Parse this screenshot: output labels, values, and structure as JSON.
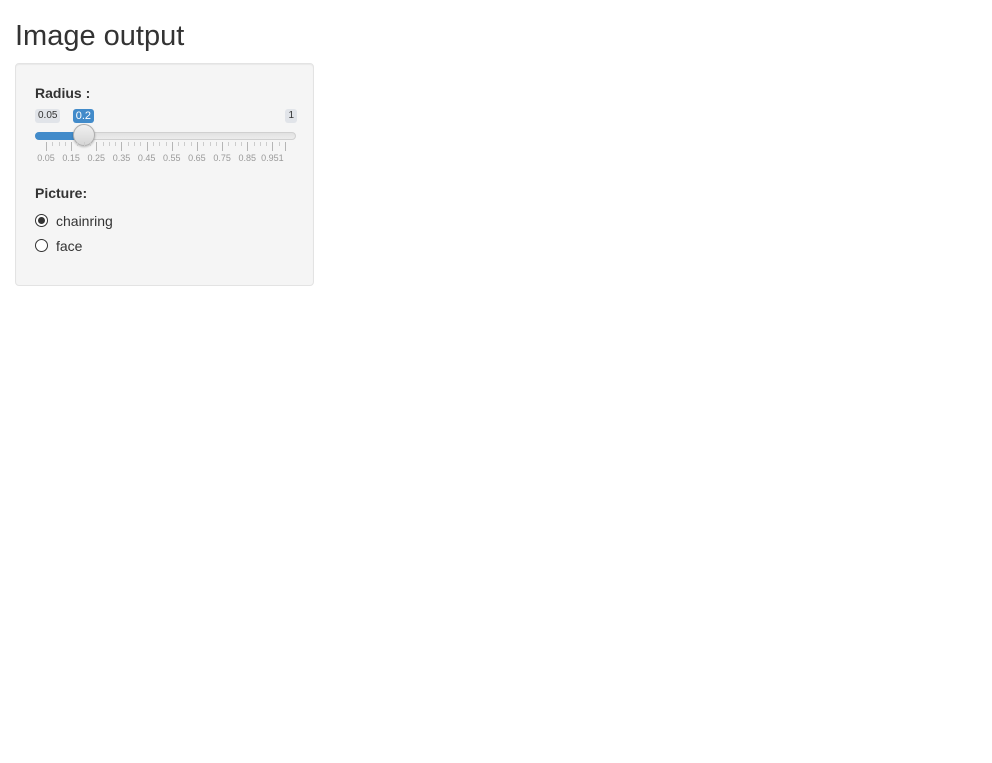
{
  "page": {
    "title": "Image output"
  },
  "radius_slider": {
    "label": "Radius :",
    "min": 0.05,
    "max": 1,
    "value": 0.2,
    "min_label": "0.05",
    "max_label": "1",
    "value_label": "0.2",
    "grid_labels": [
      "0.05",
      "0.15",
      "0.25",
      "0.35",
      "0.45",
      "0.55",
      "0.65",
      "0.75",
      "0.85",
      "0.951"
    ],
    "accent_color": "#428bca"
  },
  "picture_radio": {
    "label": "Picture:",
    "options": [
      {
        "label": "chainring",
        "selected": true
      },
      {
        "label": "face",
        "selected": false
      }
    ]
  }
}
